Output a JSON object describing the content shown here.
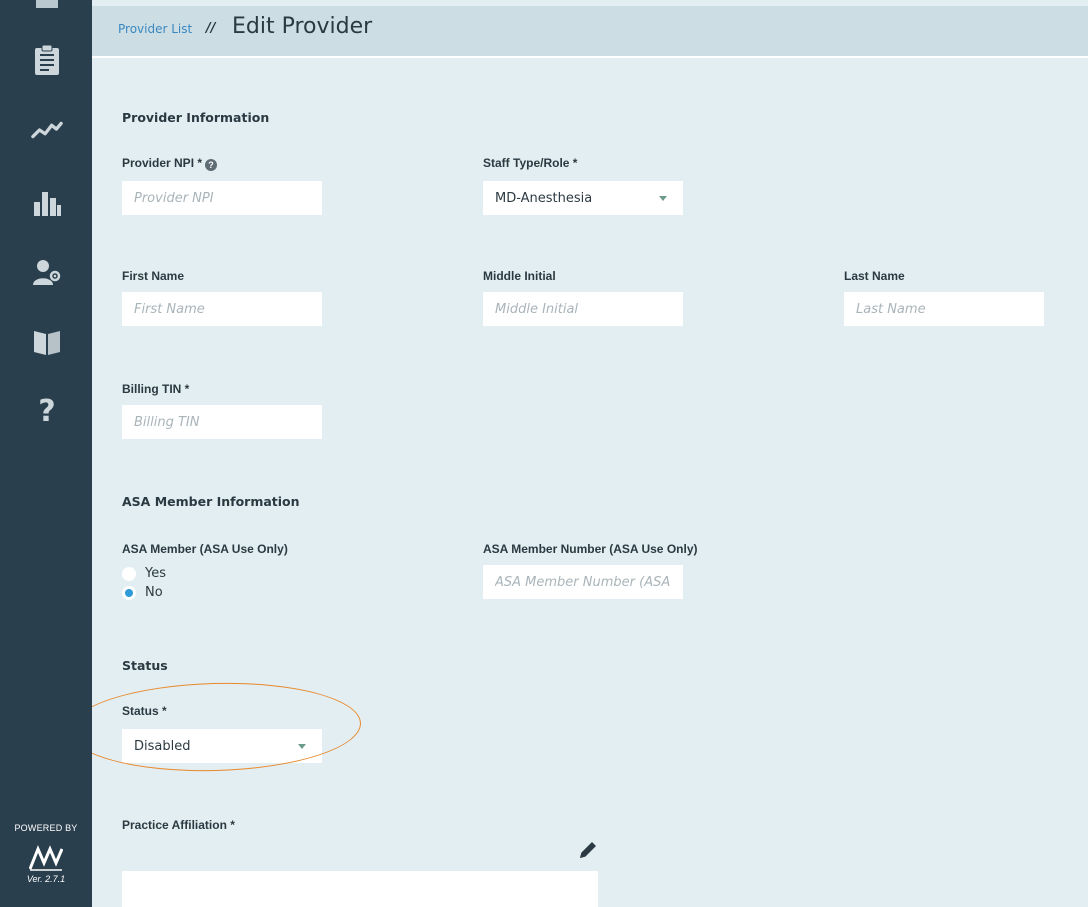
{
  "sidebar": {
    "items": [
      {
        "name": "clipboard-icon"
      },
      {
        "name": "trend-line-icon"
      },
      {
        "name": "bar-chart-icon"
      },
      {
        "name": "user-settings-icon"
      },
      {
        "name": "book-icon"
      },
      {
        "name": "help-icon"
      }
    ],
    "powered_by": "POWERED BY",
    "version": "Ver. 2.7.1"
  },
  "header": {
    "breadcrumb_link": "Provider List",
    "separator": "//",
    "title": "Edit Provider"
  },
  "provider_information": {
    "section_title": "Provider Information",
    "npi_label": "Provider NPI *",
    "npi_placeholder": "Provider NPI",
    "npi_help": "?",
    "staff_type_label": "Staff Type/Role *",
    "staff_type_value": "MD-Anesthesia",
    "first_name_label": "First Name",
    "first_name_placeholder": "First Name",
    "middle_initial_label": "Middle Initial",
    "middle_initial_placeholder": "Middle Initial",
    "last_name_label": "Last Name",
    "last_name_placeholder": "Last Name",
    "billing_tin_label": "Billing TIN *",
    "billing_tin_placeholder": "Billing TIN"
  },
  "asa_member_information": {
    "section_title": "ASA Member Information",
    "member_label": "ASA Member (ASA Use Only)",
    "options": [
      {
        "label": "Yes",
        "checked": false
      },
      {
        "label": "No",
        "checked": true
      }
    ],
    "member_number_label": "ASA Member Number (ASA Use Only)",
    "member_number_placeholder": "ASA Member Number (ASA"
  },
  "status_section": {
    "section_title": "Status",
    "status_label": "Status *",
    "status_value": "Disabled"
  },
  "practice_affiliation": {
    "label": "Practice Affiliation *"
  },
  "colors": {
    "sidebar": "#2a3f4d",
    "content_bg": "#e2eef1",
    "header_bg": "#ccdee4",
    "link": "#3a87c0",
    "radio_selected": "#2f9bd8",
    "highlight": "#e8892e"
  }
}
